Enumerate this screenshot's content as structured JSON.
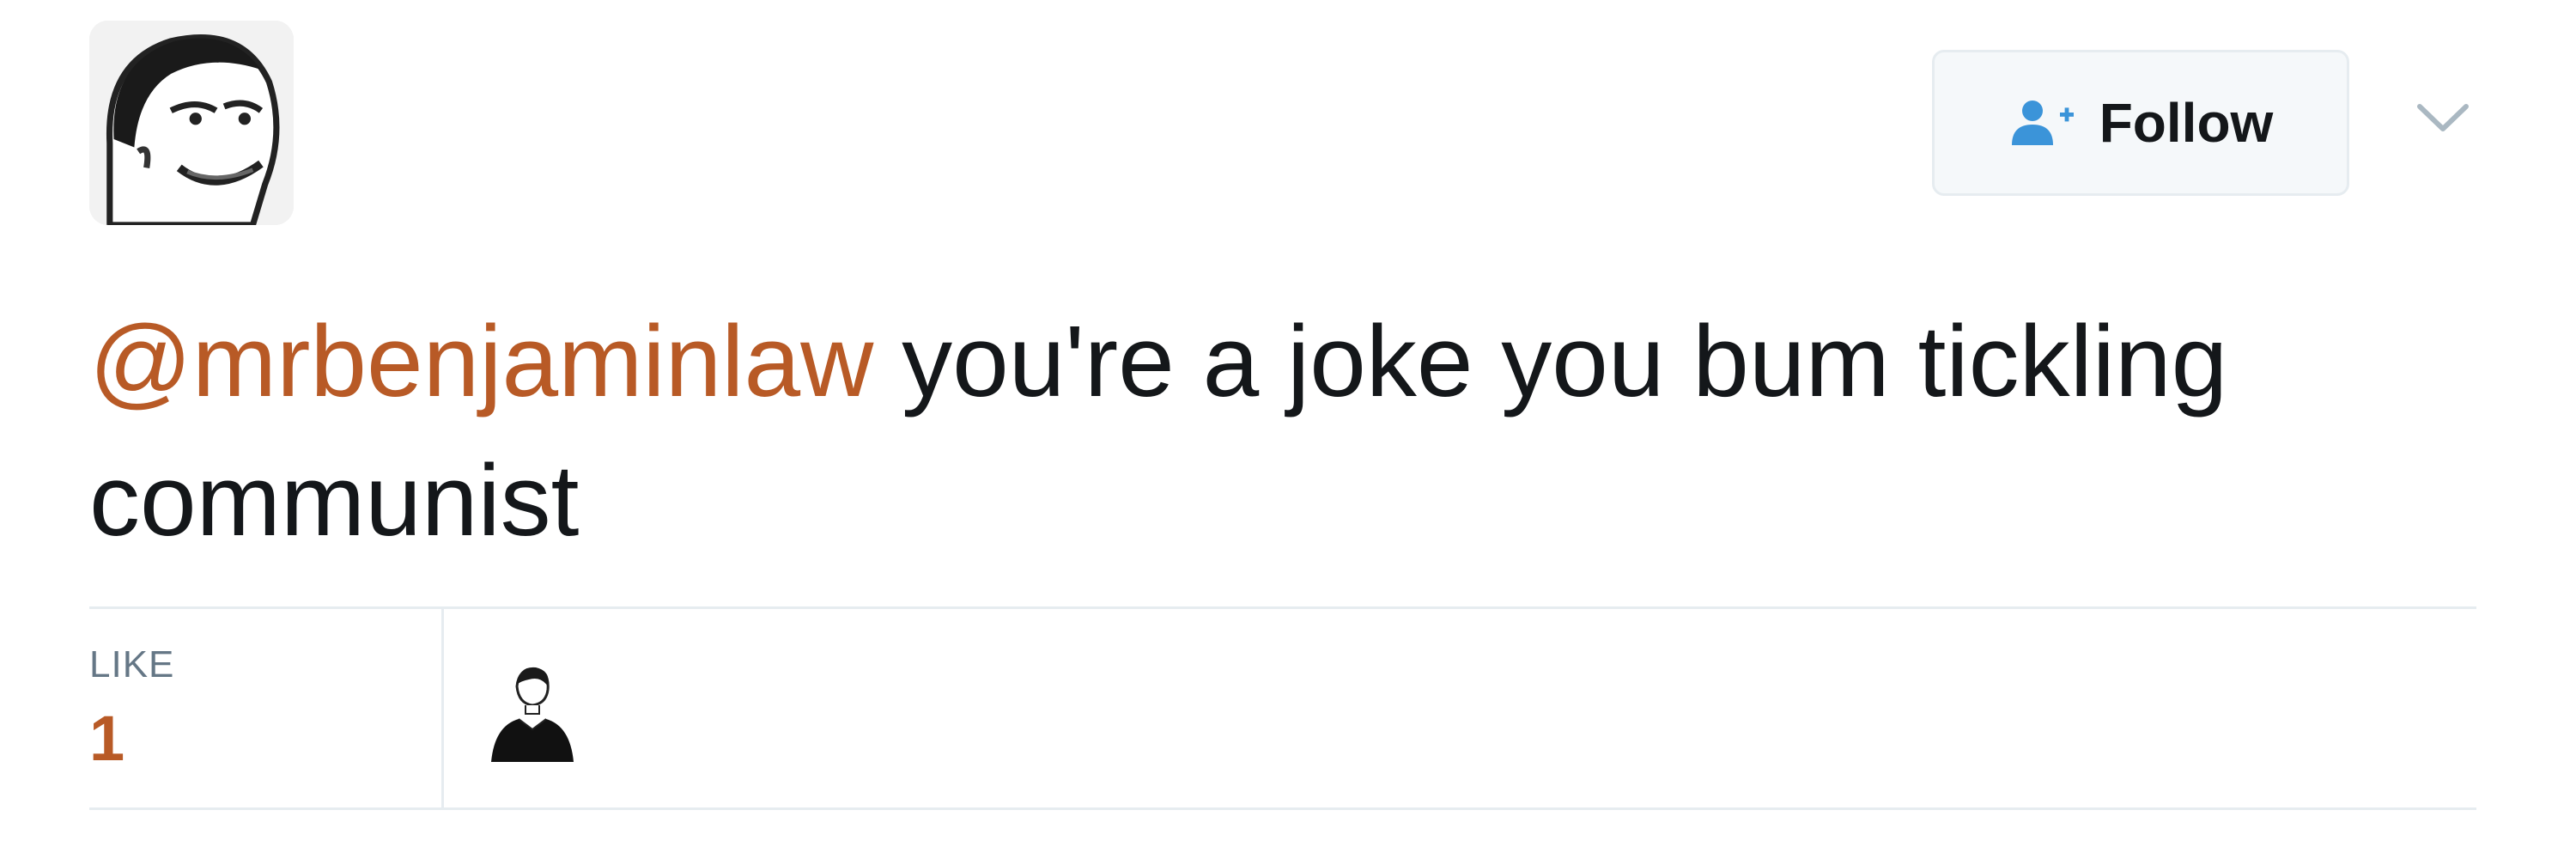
{
  "author": {
    "avatar_icon": "author-avatar"
  },
  "actions": {
    "follow_label": "Follow",
    "follow_icon": "follow-person-plus-icon",
    "menu_icon": "chevron-down-icon"
  },
  "tweet": {
    "mention": "@mrbenjaminlaw",
    "text": " you're a joke you bum tickling communist"
  },
  "stats": {
    "like_label": "LIKE",
    "like_count": "1",
    "liker_avatar_icon": "liker-avatar"
  },
  "colors": {
    "mention": "#b85a26",
    "like_count": "#b85a26",
    "follow_icon": "#3b94d9",
    "divider": "#e6ecf0",
    "muted_text": "#657786"
  }
}
